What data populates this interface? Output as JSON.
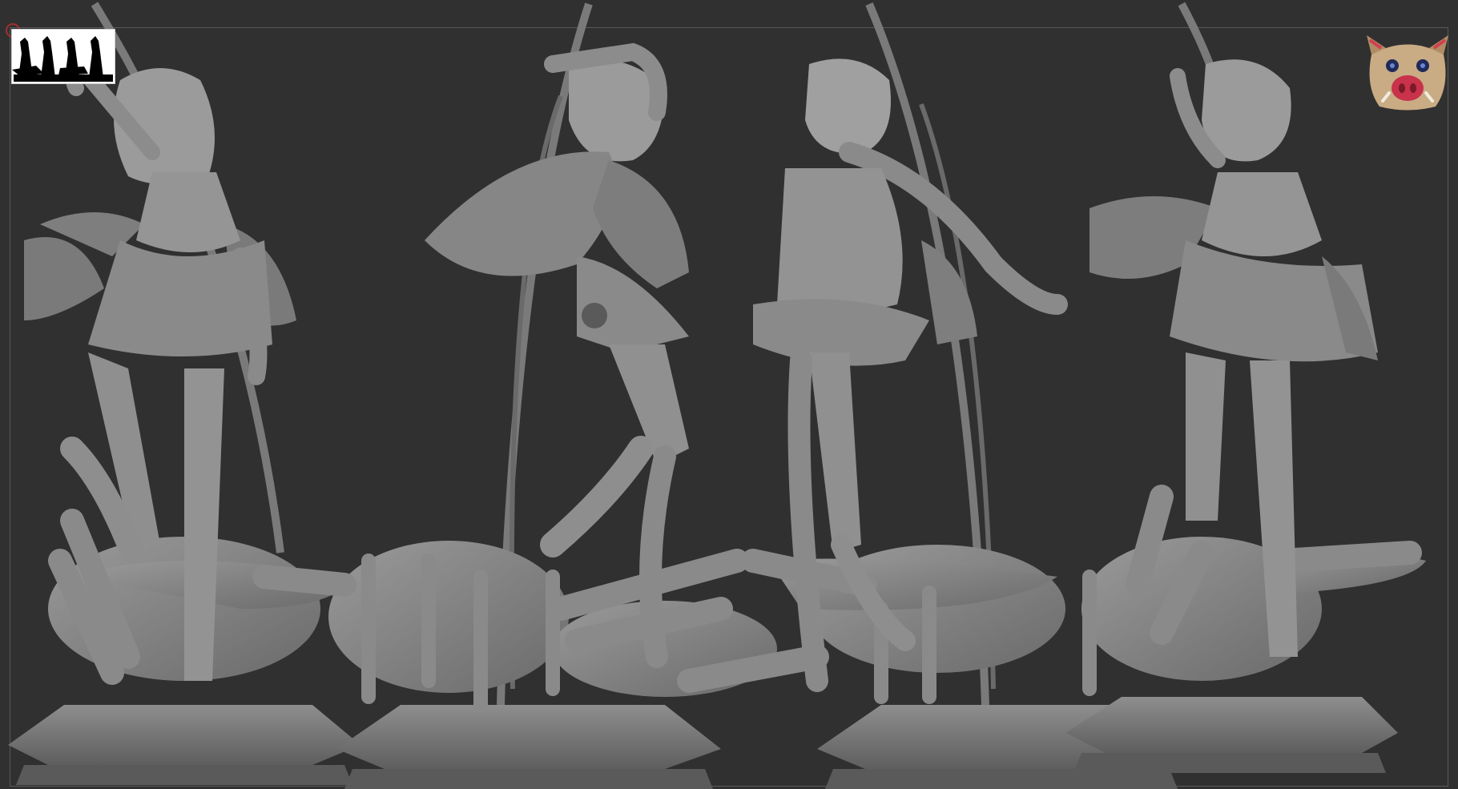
{
  "viewport": {
    "background": "#303030",
    "model_color": "#8a8a8a",
    "model_shade": "#6e6e6e",
    "model_highlight": "#a3a3a3"
  },
  "overlays": {
    "thumbnail": "figure-silhouettes-thumbnail",
    "mascot": "boar-mask-icon"
  },
  "figures": [
    {
      "view": "front"
    },
    {
      "view": "back"
    },
    {
      "view": "side"
    },
    {
      "view": "three-quarter"
    }
  ]
}
